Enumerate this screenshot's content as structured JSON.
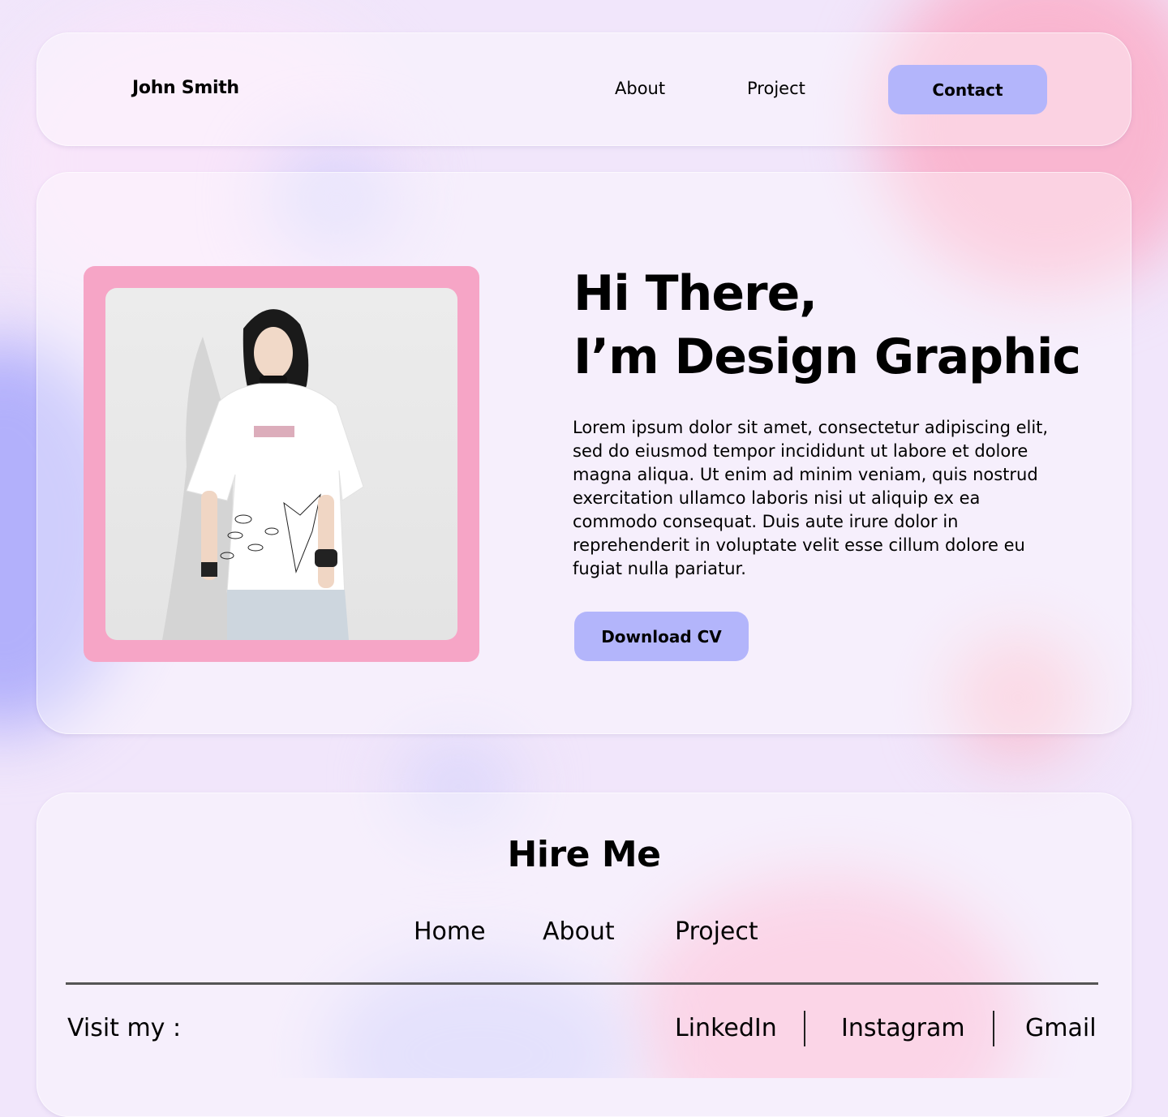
{
  "nav": {
    "brand": "John Smith",
    "links": [
      "About",
      "Project"
    ],
    "contact_label": "Contact"
  },
  "hero": {
    "headline_line1": "Hi There,",
    "headline_line2": "I’m Design Graphic",
    "intro": "Lorem ipsum dolor sit amet, consectetur adipiscing elit, sed do eiusmod tempor incididunt ut labore et dolore magna aliqua. Ut enim ad minim veniam, quis nostrud exercitation ullamco laboris nisi ut aliquip ex ea commodo consequat. Duis aute irure dolor in reprehenderit in voluptate velit esse cillum dolore eu fugiat nulla pariatur.",
    "download_label": "Download CV",
    "photo_icon": "portrait-photo"
  },
  "footer": {
    "title": "Hire Me",
    "links": [
      "Home",
      "About",
      "Project"
    ],
    "visit_label": "Visit my :",
    "social": [
      "LinkedIn",
      "Instagram",
      "Gmail"
    ]
  },
  "colors": {
    "accent_button": "#b3b5fb",
    "photo_frame": "#f6a5c6",
    "background": "#f1e6fb"
  }
}
